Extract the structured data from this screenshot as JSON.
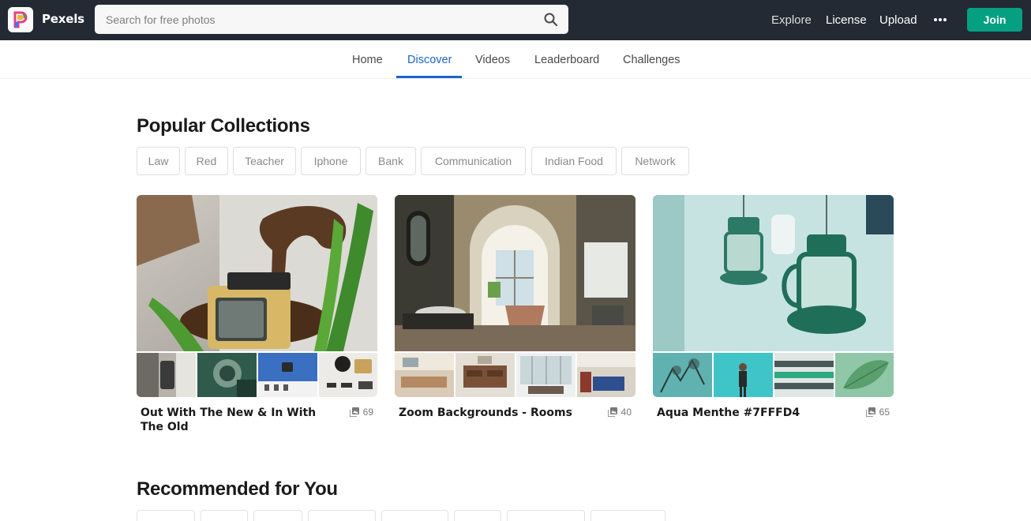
{
  "header": {
    "brand": "Pexels",
    "search_placeholder": "Search for free photos",
    "nav": {
      "explore": "Explore",
      "license": "License",
      "upload": "Upload"
    },
    "join": "Join"
  },
  "tabs": [
    "Home",
    "Discover",
    "Videos",
    "Leaderboard",
    "Challenges"
  ],
  "active_tab": "Discover",
  "popular": {
    "title": "Popular Collections",
    "tags": [
      "Law",
      "Red",
      "Teacher",
      "Iphone",
      "Bank",
      "Communication",
      "Indian Food",
      "Network"
    ],
    "collections": [
      {
        "title": "Out With The New & In With The Old",
        "count": "69"
      },
      {
        "title": "Zoom Backgrounds - Rooms",
        "count": "40"
      },
      {
        "title": "Aqua Menthe #7FFFD4",
        "count": "65"
      }
    ]
  },
  "recommended": {
    "title": "Recommended for You"
  },
  "colors": {
    "topbar": "#232a34",
    "accent": "#05a081",
    "active_tab": "#1e63c9"
  },
  "icons": [
    "search-icon",
    "more-dots-icon",
    "collection-count-icon",
    "pexels-logo"
  ]
}
